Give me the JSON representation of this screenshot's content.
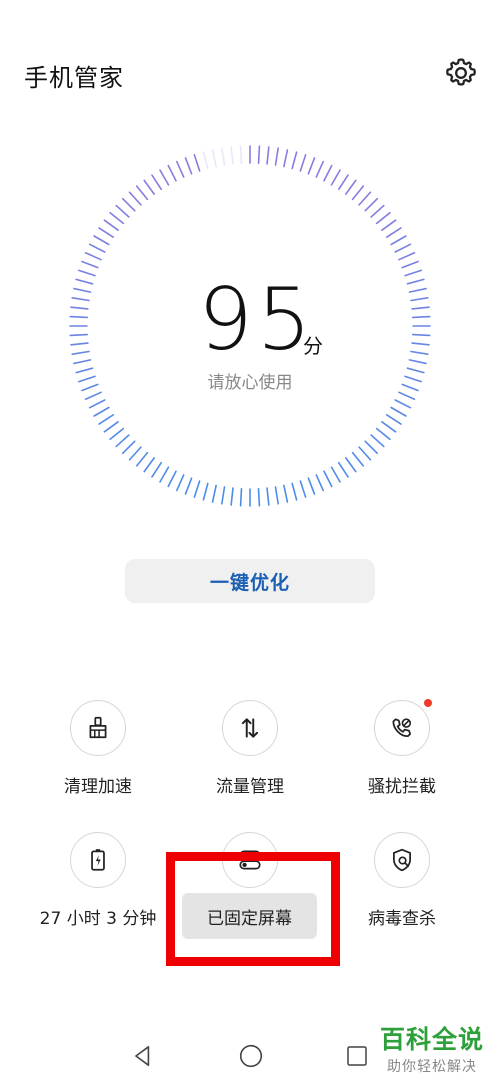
{
  "header": {
    "title": "手机管家",
    "settings_icon": "gear-icon"
  },
  "score": {
    "value": "95",
    "unit": "分",
    "subtitle": "请放心使用",
    "level_percent": 95
  },
  "colors": {
    "accent": "#1a5fb4",
    "gauge_blue": "#5b8fe6",
    "gauge_purple": "#8e7ae0",
    "highlight": "#ee0000",
    "badge": "#f03a2e",
    "watermark": "#2ea03a"
  },
  "optimize_button": {
    "label": "一键优化"
  },
  "tiles": [
    {
      "label": "清理加速",
      "icon": "broom-icon"
    },
    {
      "label": "流量管理",
      "icon": "data-arrows-icon"
    },
    {
      "label": "骚扰拦截",
      "icon": "blocked-call-icon",
      "badge": true
    },
    {
      "label": "27 小时 3 分钟",
      "icon": "battery-icon"
    },
    {
      "label": "",
      "icon": "toggle-icon"
    },
    {
      "label": "病毒查杀",
      "icon": "shield-search-icon"
    }
  ],
  "toast": {
    "text": "已固定屏幕"
  },
  "navbar": {
    "back": "back-icon",
    "home": "home-icon",
    "recent": "recent-apps-icon"
  },
  "watermark": {
    "main": "百科全说",
    "sub": "助你轻松解决"
  }
}
